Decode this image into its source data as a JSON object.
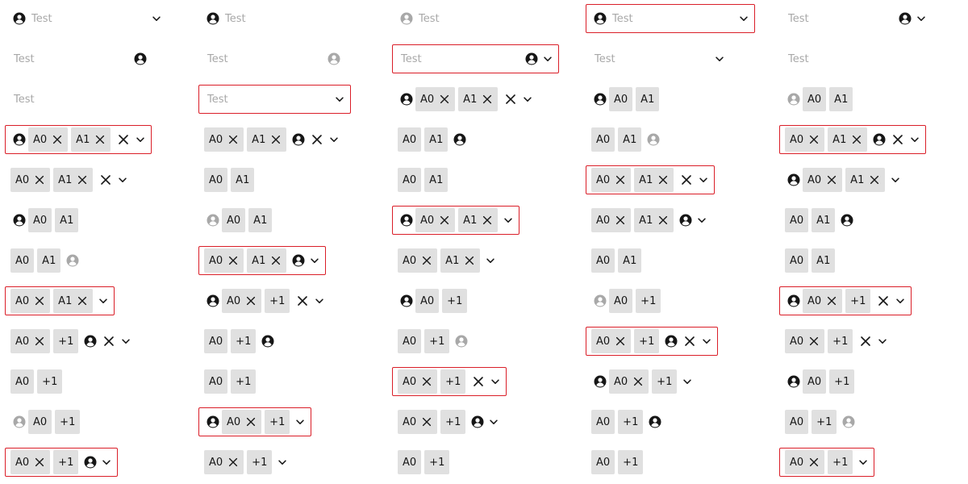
{
  "placeholder": "Test",
  "tags": {
    "a0": "A0",
    "a1": "A1",
    "more": "+1"
  },
  "colors": {
    "error_border": "#da1e28",
    "tag_bg": "#e0e0e0",
    "avatar": "#161616",
    "avatar_muted": "#a8a8a8"
  },
  "icons": {
    "avatar": "user-avatar-icon",
    "remove_tag": "close-icon",
    "clear": "close-icon",
    "open": "chevron-down-icon"
  },
  "columns": [
    [
      {
        "kind": "ph",
        "avatar": "left",
        "chev": true
      },
      {
        "kind": "ph",
        "avatar": "right"
      },
      {
        "kind": "ph"
      },
      {
        "kind": "tags",
        "tags": [
          "A0",
          "A1"
        ],
        "removable": true,
        "avatar": "left",
        "clear": true,
        "chev": true,
        "invalid": true
      },
      {
        "kind": "tags",
        "tags": [
          "A0",
          "A1"
        ],
        "removable": true,
        "clear": true,
        "chev": true
      },
      {
        "kind": "tags",
        "tags": [
          "A0",
          "A1"
        ],
        "avatar": "left"
      },
      {
        "kind": "tags",
        "tags": [
          "A0",
          "A1"
        ],
        "avatar": "right",
        "muted": true
      },
      {
        "kind": "tags",
        "tags": [
          "A0",
          "A1"
        ],
        "removable": true,
        "chev": true,
        "invalid": true
      },
      {
        "kind": "tags",
        "tags": [
          "A0",
          "+1"
        ],
        "removable": true,
        "avatar": "right",
        "clear": true,
        "chev": true
      },
      {
        "kind": "tags",
        "tags": [
          "A0",
          "+1"
        ]
      },
      {
        "kind": "tags",
        "tags": [
          "A0",
          "+1"
        ],
        "avatar": "left",
        "muted": true
      },
      {
        "kind": "tags",
        "tags": [
          "A0",
          "+1"
        ],
        "removable": true,
        "avatar": "right",
        "chev": true,
        "invalid": true
      }
    ],
    [
      {
        "kind": "ph",
        "avatar": "left"
      },
      {
        "kind": "ph",
        "avatar": "right",
        "muted": true
      },
      {
        "kind": "ph",
        "chev": true,
        "invalid": true
      },
      {
        "kind": "tags",
        "tags": [
          "A0",
          "A1"
        ],
        "removable": true,
        "avatar": "right",
        "clear": true,
        "chev": true
      },
      {
        "kind": "tags",
        "tags": [
          "A0",
          "A1"
        ]
      },
      {
        "kind": "tags",
        "tags": [
          "A0",
          "A1"
        ],
        "avatar": "left",
        "muted": true
      },
      {
        "kind": "tags",
        "tags": [
          "A0",
          "A1"
        ],
        "removable": true,
        "avatar": "right",
        "chev": true,
        "invalid": true
      },
      {
        "kind": "tags",
        "tags": [
          "A0",
          "+1"
        ],
        "removable": true,
        "avatar": "left",
        "clear": true,
        "chev": true
      },
      {
        "kind": "tags",
        "tags": [
          "A0",
          "+1"
        ],
        "avatar": "right"
      },
      {
        "kind": "tags",
        "tags": [
          "A0",
          "+1"
        ]
      },
      {
        "kind": "tags",
        "tags": [
          "A0",
          "+1"
        ],
        "removable": true,
        "avatar": "left",
        "chev": true,
        "invalid": true
      },
      {
        "kind": "tags",
        "tags": [
          "A0",
          "+1"
        ],
        "removable": true,
        "chev": true
      }
    ],
    [
      {
        "kind": "ph",
        "avatar": "left",
        "muted": true
      },
      {
        "kind": "ph",
        "avatar": "right",
        "chev": true,
        "invalid": true
      },
      {
        "kind": "tags",
        "tags": [
          "A0",
          "A1"
        ],
        "removable": true,
        "avatar": "left",
        "clear": true,
        "chev": true
      },
      {
        "kind": "tags",
        "tags": [
          "A0",
          "A1"
        ],
        "avatar": "right"
      },
      {
        "kind": "tags",
        "tags": [
          "A0",
          "A1"
        ]
      },
      {
        "kind": "tags",
        "tags": [
          "A0",
          "A1"
        ],
        "removable": true,
        "avatar": "left",
        "chev": true,
        "invalid": true
      },
      {
        "kind": "tags",
        "tags": [
          "A0",
          "A1"
        ],
        "removable": true,
        "chev": true
      },
      {
        "kind": "tags",
        "tags": [
          "A0",
          "+1"
        ],
        "avatar": "left"
      },
      {
        "kind": "tags",
        "tags": [
          "A0",
          "+1"
        ],
        "avatar": "right",
        "muted": true
      },
      {
        "kind": "tags",
        "tags": [
          "A0",
          "+1"
        ],
        "removable": true,
        "clear": true,
        "chev": true,
        "invalid": true
      },
      {
        "kind": "tags",
        "tags": [
          "A0",
          "+1"
        ],
        "removable": true,
        "avatar": "right",
        "chev": true
      },
      {
        "kind": "tags",
        "tags": [
          "A0",
          "+1"
        ]
      }
    ],
    [
      {
        "kind": "ph",
        "avatar": "left",
        "chev": true,
        "invalid": true
      },
      {
        "kind": "ph",
        "chev": true
      },
      {
        "kind": "tags",
        "tags": [
          "A0",
          "A1"
        ],
        "avatar": "left"
      },
      {
        "kind": "tags",
        "tags": [
          "A0",
          "A1"
        ],
        "avatar": "right",
        "muted": true
      },
      {
        "kind": "tags",
        "tags": [
          "A0",
          "A1"
        ],
        "removable": true,
        "clear": true,
        "chev": true,
        "invalid": true
      },
      {
        "kind": "tags",
        "tags": [
          "A0",
          "A1"
        ],
        "removable": true,
        "avatar": "right",
        "chev": true
      },
      {
        "kind": "tags",
        "tags": [
          "A0",
          "A1"
        ]
      },
      {
        "kind": "tags",
        "tags": [
          "A0",
          "+1"
        ],
        "avatar": "left",
        "muted": true
      },
      {
        "kind": "tags",
        "tags": [
          "A0",
          "+1"
        ],
        "removable": true,
        "avatar": "right",
        "clear": true,
        "chev": true,
        "invalid": true
      },
      {
        "kind": "tags",
        "tags": [
          "A0",
          "+1"
        ],
        "removable": true,
        "avatar": "left",
        "chev": true
      },
      {
        "kind": "tags",
        "tags": [
          "A0",
          "+1"
        ],
        "avatar": "right"
      },
      {
        "kind": "tags",
        "tags": [
          "A0",
          "+1"
        ]
      }
    ],
    [
      {
        "kind": "ph",
        "avatar": "right",
        "chev": true
      },
      {
        "kind": "ph"
      },
      {
        "kind": "tags",
        "tags": [
          "A0",
          "A1"
        ],
        "avatar": "left",
        "muted": true
      },
      {
        "kind": "tags",
        "tags": [
          "A0",
          "A1"
        ],
        "removable": true,
        "avatar": "right",
        "clear": true,
        "chev": true,
        "invalid": true
      },
      {
        "kind": "tags",
        "tags": [
          "A0",
          "A1"
        ],
        "removable": true,
        "avatar": "left",
        "chev": true
      },
      {
        "kind": "tags",
        "tags": [
          "A0",
          "A1"
        ],
        "avatar": "right"
      },
      {
        "kind": "tags",
        "tags": [
          "A0",
          "A1"
        ]
      },
      {
        "kind": "tags",
        "tags": [
          "A0",
          "+1"
        ],
        "removable": true,
        "avatar": "left",
        "clear": true,
        "chev": true,
        "invalid": true
      },
      {
        "kind": "tags",
        "tags": [
          "A0",
          "+1"
        ],
        "removable": true,
        "clear": true,
        "chev": true
      },
      {
        "kind": "tags",
        "tags": [
          "A0",
          "+1"
        ],
        "avatar": "left"
      },
      {
        "kind": "tags",
        "tags": [
          "A0",
          "+1"
        ],
        "avatar": "right",
        "muted": true
      },
      {
        "kind": "tags",
        "tags": [
          "A0",
          "+1"
        ],
        "removable": true,
        "chev": true,
        "invalid": true
      }
    ]
  ]
}
